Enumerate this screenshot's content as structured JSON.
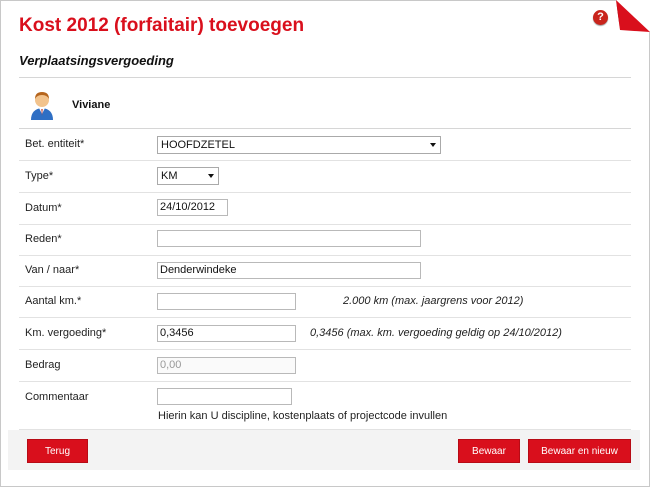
{
  "window": {
    "title": "Kost 2012 (forfaitair) toevoegen",
    "help_icon": "?"
  },
  "section": {
    "title": "Verplaatsingsvergoeding"
  },
  "user": {
    "name": "Viviane"
  },
  "form": {
    "entity_label": "Bet. entiteit*",
    "entity_value": "HOOFDZETEL",
    "type_label": "Type*",
    "type_value": "KM",
    "date_label": "Datum*",
    "date_value": "24/10/2012",
    "reason_label": "Reden*",
    "reason_value": "",
    "from_to_label": "Van / naar*",
    "from_to_value": "Denderwindeke",
    "km_label": "Aantal km.*",
    "km_value": "",
    "km_note": "2.000 km (max. jaargrens voor 2012)",
    "km_rate_label": "Km. vergoeding*",
    "km_rate_value": "0,3456",
    "km_rate_note": "0,3456 (max. km. vergoeding geldig op 24/10/2012)",
    "amount_label": "Bedrag",
    "amount_value": "0,00",
    "comment_label": "Commentaar",
    "comment_value": "",
    "comment_hint": "Hierin kan U discipline, kostenplaats of projectcode invullen"
  },
  "buttons": {
    "back": "Terug",
    "save": "Bewaar",
    "save_new": "Bewaar en nieuw"
  },
  "colors": {
    "accent": "#d90f1c"
  }
}
